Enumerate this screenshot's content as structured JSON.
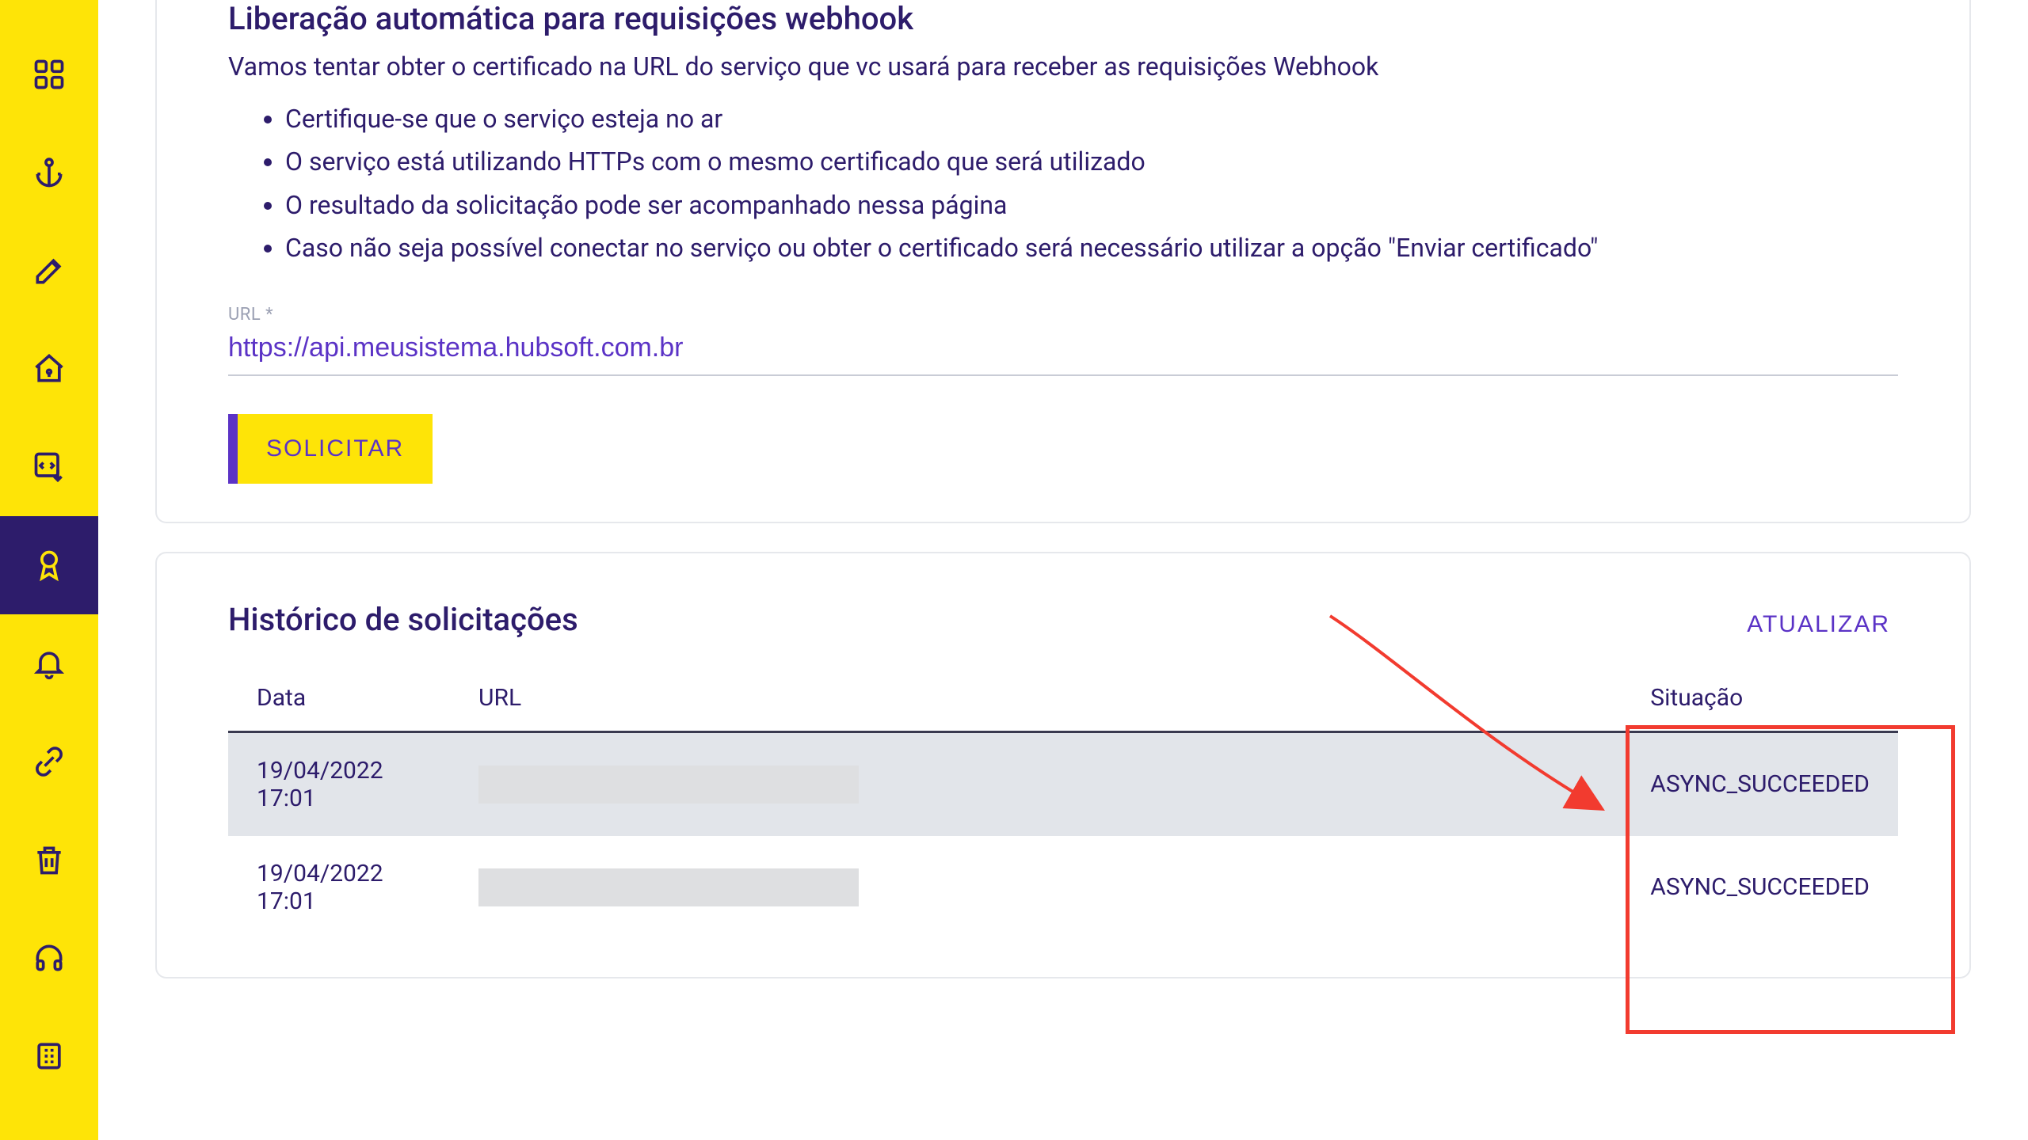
{
  "sidebar": {
    "items": [
      {
        "name": "dashboard-icon"
      },
      {
        "name": "anchor-icon"
      },
      {
        "name": "edit-icon"
      },
      {
        "name": "home-key-icon"
      },
      {
        "name": "code-download-icon"
      },
      {
        "name": "ribbon-icon",
        "active": true
      },
      {
        "name": "bell-icon"
      },
      {
        "name": "link-icon"
      },
      {
        "name": "trash-icon"
      },
      {
        "name": "headphones-icon"
      },
      {
        "name": "building-icon"
      }
    ]
  },
  "release": {
    "title": "Liberação automática para requisições webhook",
    "desc": "Vamos tentar obter o certificado na URL do serviço que vc usará para receber as requisições Webhook",
    "bullets": [
      "Certifique-se que o serviço esteja no ar",
      "O serviço está utilizando HTTPs com o mesmo certificado que será utilizado",
      "O resultado da solicitação pode ser acompanhado nessa página",
      "Caso não seja possível conectar no serviço ou obter o certificado será necessário utilizar a opção \"Enviar certificado\""
    ],
    "url_label": "URL *",
    "url_value": "https://api.meusistema.hubsoft.com.br",
    "solicitar": "SOLICITAR"
  },
  "history": {
    "title": "Histórico de solicitações",
    "atualizar": "ATUALIZAR",
    "columns": {
      "data": "Data",
      "url": "URL",
      "situacao": "Situação"
    },
    "rows": [
      {
        "data": "19/04/2022 17:01",
        "url": "",
        "situacao": "ASYNC_SUCCEEDED"
      },
      {
        "data": "19/04/2022 17:01",
        "url": "",
        "situacao": "ASYNC_SUCCEEDED"
      }
    ]
  }
}
